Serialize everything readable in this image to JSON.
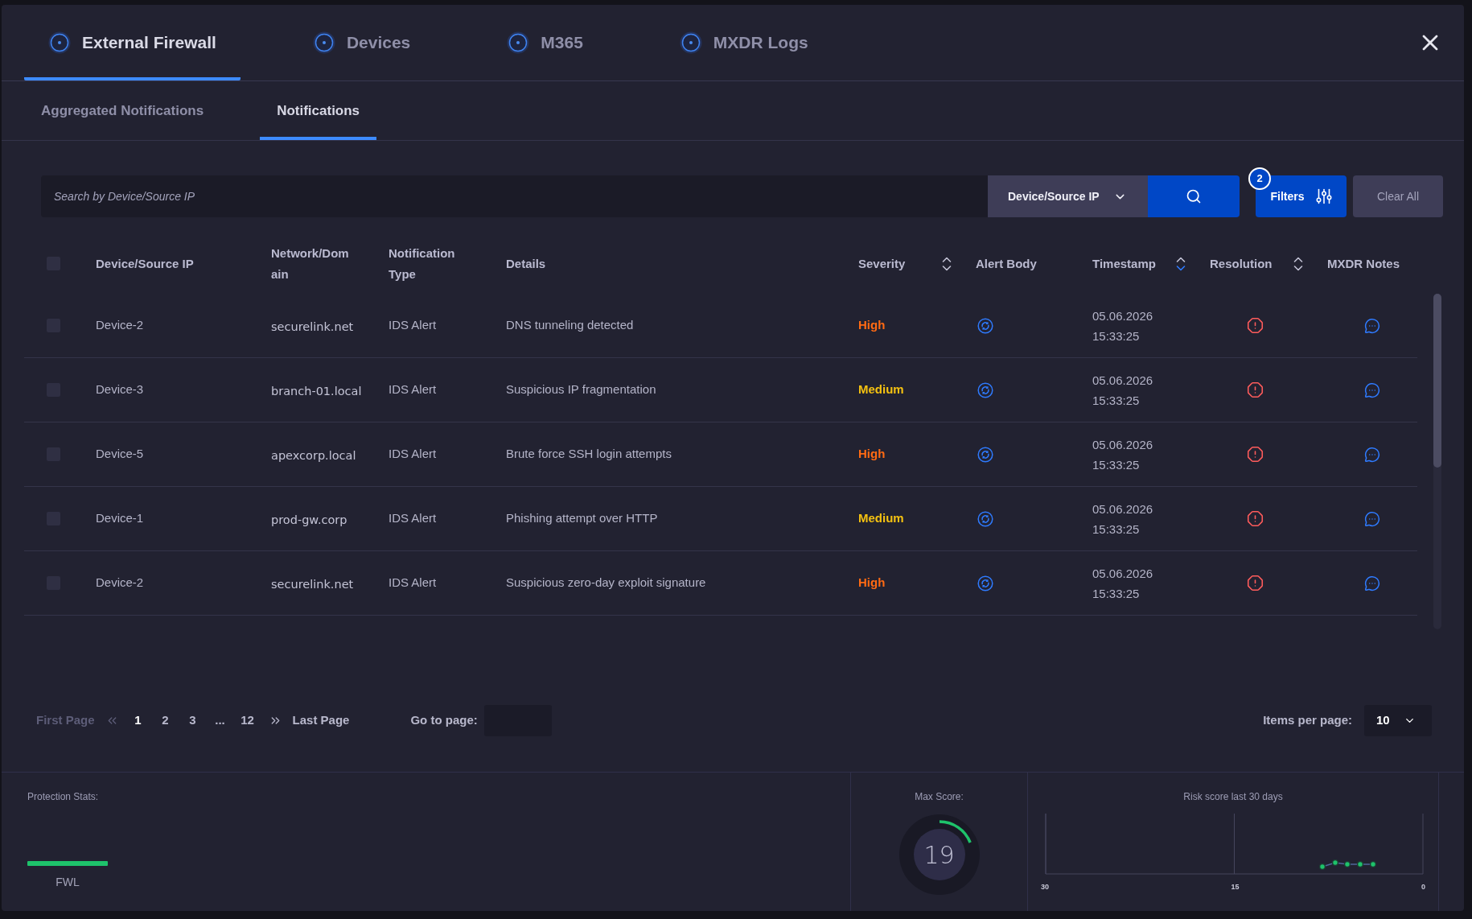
{
  "tabs": [
    {
      "label": "External Firewall",
      "selected": true
    },
    {
      "label": "Devices",
      "selected": false
    },
    {
      "label": "M365",
      "selected": false
    },
    {
      "label": "MXDR Logs",
      "selected": false
    }
  ],
  "subtabs": [
    {
      "label": "Aggregated Notifications",
      "selected": false
    },
    {
      "label": "Notifications",
      "selected": true
    }
  ],
  "search": {
    "placeholder": "Search by Device/Source IP",
    "field_dropdown": {
      "value": "Device/Source IP"
    }
  },
  "filters_button": {
    "label": "Filters",
    "badge": "2"
  },
  "clear_all_button": {
    "label": "Clear All"
  },
  "table": {
    "select_all_checked": false,
    "columns": [
      {
        "label": "Device/Source IP",
        "sortable": false
      },
      {
        "label": "Network/Domain",
        "sortable": false
      },
      {
        "label": "Notification Type",
        "sortable": false
      },
      {
        "label": "Details",
        "sortable": false
      },
      {
        "label": "Severity",
        "sortable": true,
        "sorted": false
      },
      {
        "label": "Alert Body",
        "sortable": false
      },
      {
        "label": "Timestamp",
        "sortable": true,
        "sorted": true
      },
      {
        "label": "Resolution",
        "sortable": true,
        "sorted": false
      },
      {
        "label": "MXDR Notes",
        "sortable": false
      }
    ],
    "rows": [
      {
        "checked": false,
        "device": "Device-2",
        "network": "securelink.net",
        "type": "IDS Alert",
        "details": "DNS tunneling detected",
        "severity": {
          "label": "High",
          "color": "#ff6a13"
        },
        "timestamp": "05.06.2026 15:33:25"
      },
      {
        "checked": false,
        "device": "Device-3",
        "network": "branch-01.local",
        "type": "IDS Alert",
        "details": "Suspicious IP fragmentation",
        "severity": {
          "label": "Medium",
          "color": "#f5c211"
        },
        "timestamp": "05.06.2026 15:33:25"
      },
      {
        "checked": false,
        "device": "Device-5",
        "network": "apexcorp.local",
        "type": "IDS Alert",
        "details": "Brute force SSH login attempts",
        "severity": {
          "label": "High",
          "color": "#ff6a13"
        },
        "timestamp": "05.06.2026 15:33:25"
      },
      {
        "checked": false,
        "device": "Device-1",
        "network": "prod-gw.corp",
        "type": "IDS Alert",
        "details": "Phishing attempt over HTTP",
        "severity": {
          "label": "Medium",
          "color": "#f5c211"
        },
        "timestamp": "05.06.2026 15:33:25"
      },
      {
        "checked": false,
        "device": "Device-2",
        "network": "securelink.net",
        "type": "IDS Alert",
        "details": "Suspicious zero-day exploit signature",
        "severity": {
          "label": "High",
          "color": "#ff6a13"
        },
        "timestamp": "05.06.2026 15:33:25"
      }
    ]
  },
  "pagination": {
    "first": {
      "label": "First Page",
      "disabled": true
    },
    "pages": [
      {
        "label": "1",
        "selected": true
      },
      {
        "label": "2",
        "selected": false
      },
      {
        "label": "3",
        "selected": false
      },
      {
        "label": "...",
        "selected": false
      },
      {
        "label": "12",
        "selected": false
      }
    ],
    "last": {
      "label": "Last Page",
      "disabled": false
    },
    "go_to_page": {
      "label": "Go to page:"
    },
    "items_per_page": {
      "label": "Items per page:",
      "value": "10"
    }
  },
  "footer": {
    "protection_stats": {
      "title": "Protection Stats:",
      "items": [
        {
          "label": "FWL"
        }
      ]
    },
    "max_score": {
      "title": "Max Score:",
      "value": "19",
      "level": 0.19
    },
    "risk_chart": {
      "title": "Risk score last 30 days",
      "axis_labels": [
        "30",
        "15",
        "0"
      ]
    }
  }
}
